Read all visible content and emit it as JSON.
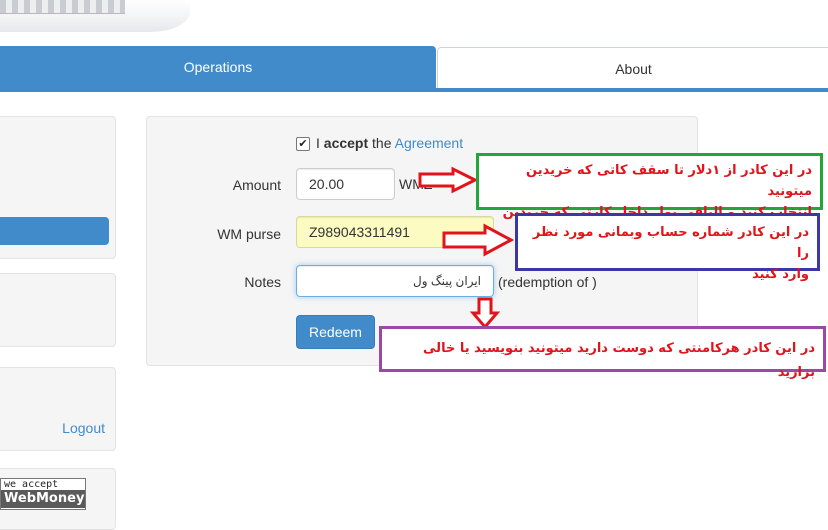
{
  "tabs": [
    {
      "label": "Operations"
    },
    {
      "label": "About"
    }
  ],
  "sidebar": {
    "logout_label": "Logout",
    "badge": {
      "line1": "we accept",
      "line2": "WebMoney"
    }
  },
  "form": {
    "accept": {
      "prefix": "I",
      "bold": "accept",
      "middle": "the",
      "link": "Agreement",
      "checked": true
    },
    "amount": {
      "label": "Amount",
      "value": "20.00",
      "suffix": "WMZ"
    },
    "purse": {
      "label": "WM purse",
      "value": "Z989043311491"
    },
    "notes": {
      "label": "Notes",
      "value": "ایران پینگ ول",
      "suffix": "(redemption of )"
    },
    "redeem_label": "Redeem"
  },
  "annotations": {
    "green": {
      "line1": "در این کادر از ۱دلار تا سقف کاتی که خریدین میتونید",
      "line2": "انتخاب کنید و الباقی پول داخل کارتی که خریدین باقی"
    },
    "blue": {
      "line1": "در این کادر شماره حساب وبمانی مورد نظر را",
      "line2": "وارد کنید"
    },
    "purple": {
      "line1": "در این کادر هرکامنتی که دوست دارید میتونید بنویسید یا خالی بزارید"
    }
  },
  "colors": {
    "primary": "#428bca",
    "annotation_text": "#e0141a",
    "arrow": "#e0141a",
    "green": "#22a539",
    "blue": "#3a37a6",
    "purple": "#9a4aa6"
  }
}
